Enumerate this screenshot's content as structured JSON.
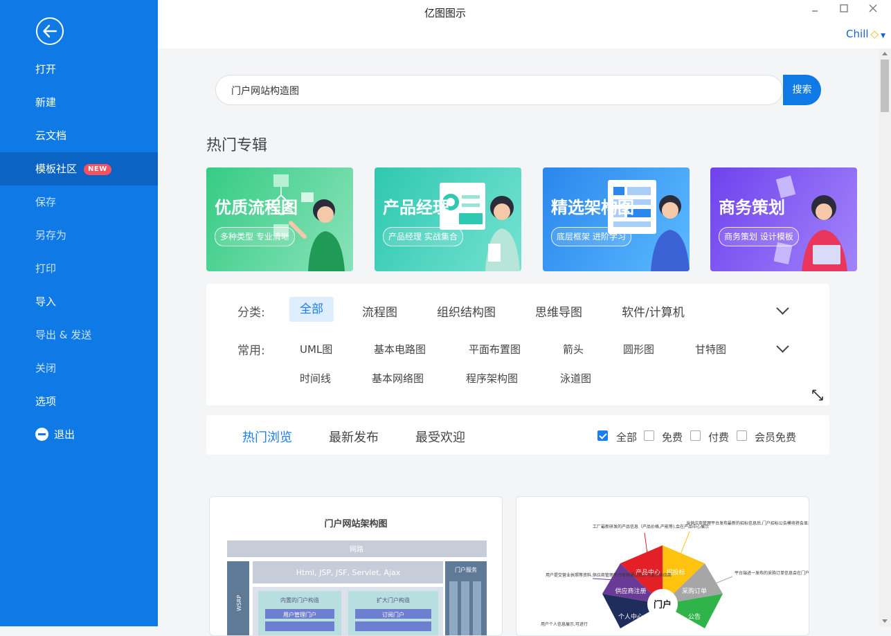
{
  "app": {
    "title": "亿图图示"
  },
  "user": {
    "name": "Chill"
  },
  "sidebar": {
    "items": [
      {
        "label": "打开"
      },
      {
        "label": "新建"
      },
      {
        "label": "云文档"
      },
      {
        "label": "模板社区",
        "badge": "NEW"
      },
      {
        "label": "保存"
      },
      {
        "label": "另存为"
      },
      {
        "label": "打印"
      },
      {
        "label": "导入"
      },
      {
        "label": "导出 & 发送"
      },
      {
        "label": "关闭"
      },
      {
        "label": "选项"
      },
      {
        "label": "退出"
      }
    ]
  },
  "search": {
    "value": "门户网站构造图",
    "button": "搜索"
  },
  "featured": {
    "title": "热门专辑",
    "banners": [
      {
        "title": "优质流程图",
        "subtitle": "多种类型 专业清晰",
        "color_from": "#37cf88",
        "color_to": "#7fe0b3"
      },
      {
        "title": "产品经理",
        "subtitle": "产品经理 实战集合",
        "color_from": "#2fc8b0",
        "color_to": "#6ee0cf"
      },
      {
        "title": "精选架构图",
        "subtitle": "底层框架 进阶学习",
        "color_from": "#2e8ff0",
        "color_to": "#5ab7ff"
      },
      {
        "title": "商务策划",
        "subtitle": "商务策划 设计模板",
        "color_from": "#7646f0",
        "color_to": "#9b7cf8"
      }
    ]
  },
  "filters": {
    "category_label": "分类:",
    "categories": [
      "全部",
      "流程图",
      "组织结构图",
      "思维导图",
      "软件/计算机"
    ],
    "common_label": "常用:",
    "common_row1": [
      "UML图",
      "基本电路图",
      "平面布置图",
      "箭头",
      "圆形图",
      "甘特图"
    ],
    "common_row2": [
      "时间线",
      "基本网络图",
      "程序架构图",
      "泳道图"
    ]
  },
  "sort": {
    "tabs": [
      "热门浏览",
      "最新发布",
      "最受欢迎"
    ],
    "price_filters": [
      {
        "label": "全部",
        "checked": true
      },
      {
        "label": "免费",
        "checked": false
      },
      {
        "label": "付费",
        "checked": false
      },
      {
        "label": "会员免费",
        "checked": false
      }
    ]
  },
  "cards": [
    {
      "title": "门户网站架构图",
      "labels": {
        "network": "网路",
        "tech": "Html, JSP, JSF, Servlet, Ajax",
        "portal": "门户服务",
        "left": "WSRP",
        "inner1": "内置的门户构造",
        "inner1_item": "用户管理门户",
        "inner2": "扩大门户构造",
        "inner2_item": "订阅门户"
      }
    },
    {
      "labels": {
        "center": "门户",
        "s1": "产品中心",
        "s2": "招投标",
        "s3": "采购订单",
        "s4": "公告",
        "s5": "个人中心",
        "s6": "供应商注册",
        "note1": "工厂最新研发的产品信息（产品价格,产能等),会在产品中心展示",
        "note2": "当供应商管理平台发布最新的招标信息后,门户招标公告模块将会显示,符合标准的供应商可进行投标操作",
        "note3": "用户提交营业执照等资料,供应商管理平台审核通过后方可成为供应商",
        "note4": "平台端进一发布的采购订单信息会在门户端进行展示,供应商可进行相应的供货操作",
        "note5": "用户个人信息展示,可进行"
      }
    }
  ]
}
